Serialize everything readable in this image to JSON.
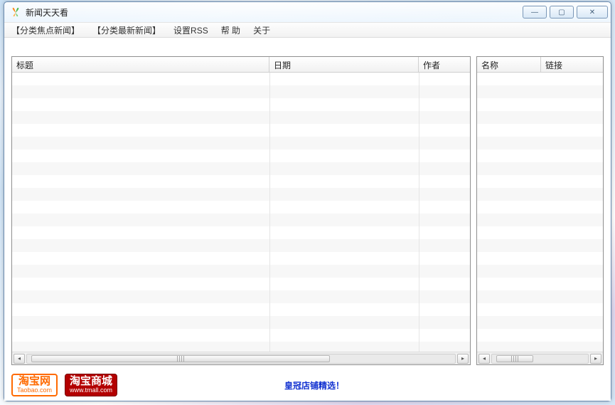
{
  "window": {
    "title": "新闻天天看"
  },
  "menu": {
    "focus_news": "【分类焦点新闻】",
    "latest_news": "【分类最新新闻】",
    "set_rss": "设置RSS",
    "help": "帮 助",
    "about": "关于"
  },
  "tables": {
    "left": {
      "cols": {
        "title": "标题",
        "date": "日期",
        "author": "作者"
      },
      "rows": []
    },
    "right": {
      "cols": {
        "name": "名称",
        "link": "链接"
      },
      "rows": []
    }
  },
  "bottom": {
    "taobao_cn": "淘宝网",
    "taobao_en": "Taobao.com",
    "tmall_cn": "淘宝商城",
    "tmall_en": "www.tmall.com",
    "shop_link": "皇冠店铺精选！"
  },
  "icons": {
    "app": "butterfly-icon",
    "minimize": "—",
    "maximize": "▢",
    "close": "✕",
    "left_arrow": "◂",
    "right_arrow": "▸"
  }
}
